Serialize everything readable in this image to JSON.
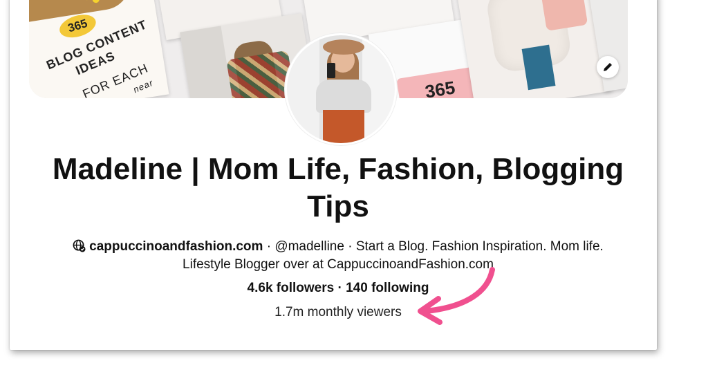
{
  "cover": {
    "tile_number": "365",
    "tile_lines": [
      "BLOG CONTENT",
      "IDEAS",
      "FOR EACH"
    ],
    "tile_small": "near",
    "tile2_number": "365"
  },
  "profile": {
    "name_line1": "Madeline | Mom Life, Fashion, Blogging",
    "name_line2": "Tips",
    "website": "cappuccinoandfashion.com",
    "sep1": " · ",
    "handle": "@madelline",
    "sep2": " · ",
    "bio_line1": "Start a Blog. Fashion Inspiration. Mom life.",
    "bio_line2": "Lifestyle Blogger over at CappuccinoandFashion.com",
    "followers": "4.6k followers",
    "sep3": " · ",
    "following": "140 following",
    "monthly_viewers": "1.7m monthly viewers"
  },
  "icons": {
    "edit": "pencil-icon",
    "website": "globe-check-icon",
    "annotation": "pink-arrow"
  },
  "colors": {
    "arrow": "#f0508f",
    "text": "#111111"
  }
}
